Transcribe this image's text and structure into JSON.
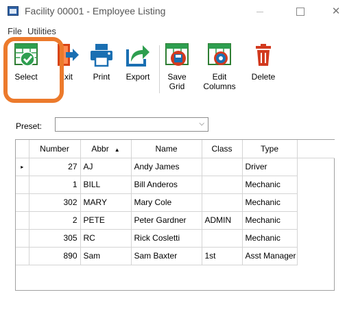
{
  "window": {
    "title": "Facility 00001 - Employee Listing",
    "controls": {
      "minimize": "",
      "maximize": "",
      "close": "✕"
    }
  },
  "menu": {
    "file": "File",
    "utilities": "Utilities"
  },
  "toolbar": {
    "select": "Select",
    "exit": "Exit",
    "print": "Print",
    "export": "Export",
    "save_grid_1": "Save",
    "save_grid_2": "Grid",
    "edit_columns_1": "Edit",
    "edit_columns_2": "Columns",
    "delete": "Delete"
  },
  "colors": {
    "highlight": "#ec7a2c",
    "green_icon": "#2e9e4f",
    "blue_icon": "#1a6fb2",
    "red_icon": "#d23a1f"
  },
  "preset": {
    "label": "Preset:",
    "value": ""
  },
  "grid": {
    "columns": [
      "Number",
      "Abbr",
      "Name",
      "Class",
      "Type"
    ],
    "sort_indicator": "▲",
    "current_row_indicator": "▸",
    "rows": [
      {
        "number": "27",
        "abbr": "AJ",
        "name": "Andy James",
        "class": "",
        "type": "Driver"
      },
      {
        "number": "1",
        "abbr": "BILL",
        "name": "Bill Anderos",
        "class": "",
        "type": "Mechanic"
      },
      {
        "number": "302",
        "abbr": "MARY",
        "name": "Mary Cole",
        "class": "",
        "type": "Mechanic"
      },
      {
        "number": "2",
        "abbr": "PETE",
        "name": "Peter Gardner",
        "class": "ADMIN",
        "type": "Mechanic"
      },
      {
        "number": "305",
        "abbr": "RC",
        "name": "Rick Cosletti",
        "class": "",
        "type": "Mechanic"
      },
      {
        "number": "890",
        "abbr": "Sam",
        "name": "Sam Baxter",
        "class": "1st",
        "type": "Asst Manager"
      }
    ]
  }
}
